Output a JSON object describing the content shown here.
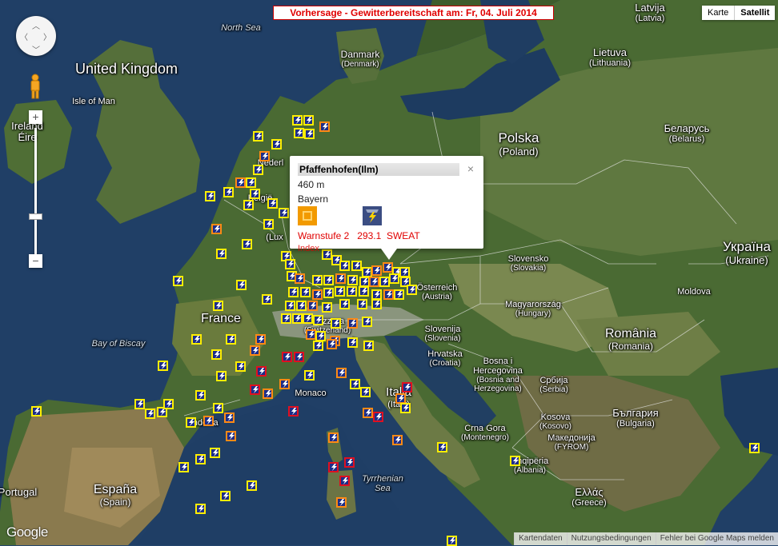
{
  "title": "Vorhersage - Gewitterbereitschaft am: Fr, 04. Juli 2014",
  "map_type": {
    "map_label": "Karte",
    "satellite_label": "Satellit"
  },
  "zoom": {
    "plus": "+",
    "minus": "−"
  },
  "popup": {
    "name": "Pfaffenhofen(Ilm)",
    "altitude": "460 m",
    "region": "Bayern",
    "warnstufe": "Warnstufe 2",
    "value": "293.1",
    "index_name": "SWEAT",
    "index_label": "Index",
    "close": "×"
  },
  "labels": {
    "united_kingdom": "United Kingdom",
    "isle_of_man": "Isle of Man",
    "ireland": "Ireland",
    "ireland_sub": "Éire",
    "north_sea": "North Sea",
    "danmark": "Danmark",
    "danmark_sub": "(Denmark)",
    "latvija": "Latvija",
    "latvija_sub": "(Latvia)",
    "lietuva": "Lietuva",
    "lietuva_sub": "(Lithuania)",
    "polska": "Polska",
    "polska_sub": "(Poland)",
    "belarus": "Беларусь",
    "belarus_sub": "(Belarus)",
    "ukraina": "Україна",
    "ukraina_sub": "(Ukraine)",
    "nederland": "Nederl",
    "belgie": "België",
    "lux": "(Lux",
    "france": "France",
    "bay_of_biscay": "Bay of Biscay",
    "slovensko": "Slovensko",
    "slovensko_sub": "(Slovakia)",
    "osterreich": "Österreich",
    "osterreich_sub": "(Austria)",
    "magyarorszag": "Magyarország",
    "magyarorszag_sub": "(Hungary)",
    "moldova": "Moldova",
    "romania": "România",
    "romania_sub": "(Romania)",
    "svizzera": "Svizzera",
    "svizzera_sub": "(Switzerland)",
    "slovenija": "Slovenija",
    "slovenija_sub": "(Slovenia)",
    "hrvatska": "Hrvatska",
    "hrvatska_sub": "(Croatia)",
    "bosna": "Bosna i",
    "bosna_2": "Hercegovina",
    "bosna_sub": "(Bosnia and",
    "bosna_sub2": "Herzegovina)",
    "srbija": "Србија",
    "srbija_sub": "(Serbia)",
    "bulgaria": "България",
    "bulgaria_sub": "(Bulgaria)",
    "monaco": "Monaco",
    "italia": "Italia",
    "italia_sub": "(Italy)",
    "crna_gora": "Crna Gora",
    "crna_gora_sub": "(Montenegro)",
    "kosova": "Kosova",
    "kosova_sub": "(Kosovo)",
    "makedonija": "Македонија",
    "makedonija_sub": "(FYROM)",
    "shqiperia": "Shqipëria",
    "shqiperia_sub": "(Albania)",
    "ellas": "Ελλάς",
    "ellas_sub": "(Greece)",
    "espana": "España",
    "espana_sub": "(Spain)",
    "portugal": "Portugal",
    "andorra": "Andorra",
    "tyrrhenian": "Tyrrhenian",
    "tyrrhenian_2": "Sea"
  },
  "footer": {
    "kartendaten": "Kartendaten",
    "nutzungsbedingungen": "Nutzungsbedingungen",
    "fehler": "Fehler bei Google Maps melden"
  },
  "google_logo": "Google",
  "colors": {
    "level1": "#ffee00",
    "level2": "#ff8a14",
    "level3": "#e01020",
    "title_red": "#e00000"
  }
}
